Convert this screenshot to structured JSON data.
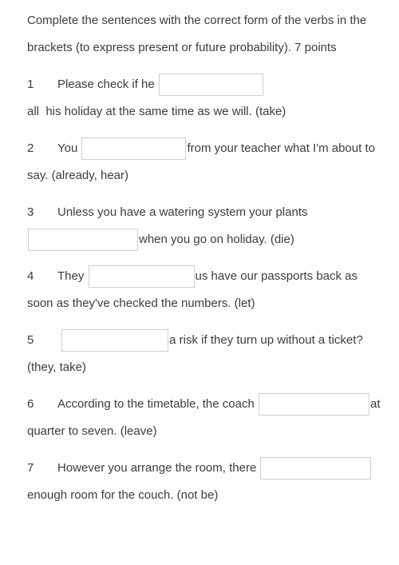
{
  "exercise": {
    "instructions": "Complete the sentences with the correct form of the verbs in the brackets (to express present or future probability). 7 points",
    "points_label": "7 points",
    "blank_placeholder": "",
    "blank_value": "",
    "items": [
      {
        "number": "1",
        "text_before": "Please check if he",
        "text_after": "all  his holiday at the same time as we will. (take)",
        "hint": "(take)"
      },
      {
        "number": "2",
        "text_before": "You",
        "text_after": "from your teacher what I'm about to say. (already, hear)",
        "hint": "(already, hear)"
      },
      {
        "number": "3",
        "text_before": "Unless you have a watering system your plants",
        "text_after": "when you go on holiday. (die)",
        "hint": "(die)"
      },
      {
        "number": "4",
        "text_before": "They",
        "text_after": "us have our passports back as soon as they've checked the numbers. (let)",
        "hint": "(let)"
      },
      {
        "number": "5",
        "text_before": "",
        "text_after": "a risk if they turn up without a ticket? (they, take)",
        "hint": "(they, take)"
      },
      {
        "number": "6",
        "text_before": "According to the timetable, the coach",
        "text_after": "at quarter to seven. (leave)",
        "hint": "(leave)"
      },
      {
        "number": "7",
        "text_before": "However you arrange the room, there",
        "text_after": "enough room for the couch. (not be)",
        "hint": "(not be)"
      }
    ]
  }
}
